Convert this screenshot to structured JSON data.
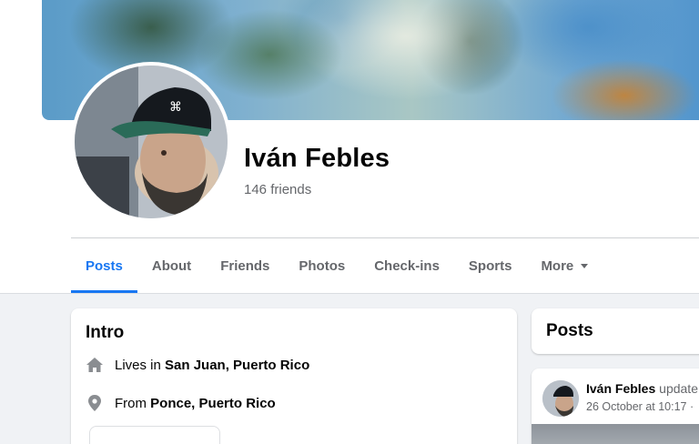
{
  "profile": {
    "name": "Iván Febles",
    "friends": "146 friends"
  },
  "tabs": [
    {
      "label": "Posts"
    },
    {
      "label": "About"
    },
    {
      "label": "Friends"
    },
    {
      "label": "Photos"
    },
    {
      "label": "Check-ins"
    },
    {
      "label": "Sports"
    },
    {
      "label": "More"
    }
  ],
  "intro": {
    "title": "Intro",
    "lives_prefix": "Lives in",
    "lives_place": "San Juan, Puerto Rico",
    "from_prefix": "From",
    "from_place": "Ponce, Puerto Rico"
  },
  "posts_section": {
    "title": "Posts"
  },
  "post": {
    "author": "Iván Febles",
    "action": "update",
    "time": "26 October at 10:17 ·"
  },
  "colors": {
    "accent": "#1877f2",
    "background": "#f0f2f5",
    "secondary_text": "#65676b"
  },
  "icons": [
    "home-icon",
    "location-pin-icon",
    "dropdown-caret-icon"
  ]
}
